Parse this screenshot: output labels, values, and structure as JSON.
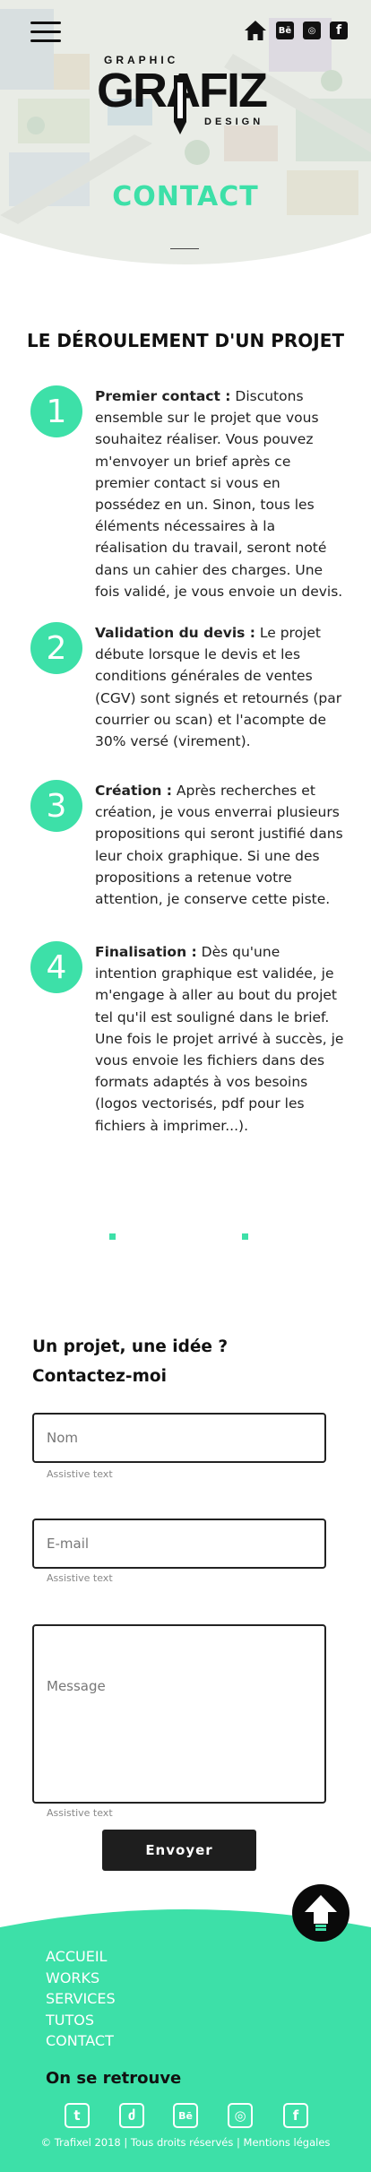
{
  "header": {
    "menu_icon": "hamburger-menu-icon",
    "icons": [
      "home-icon",
      "behance-icon",
      "dribbble-icon",
      "facebook-icon"
    ],
    "behance_glyph": "Bē",
    "dribbble_glyph": "◎",
    "facebook_glyph": "f"
  },
  "logo": {
    "top": "GRAPHIC",
    "main": "GRAFIZ",
    "bottom": "DESIGN"
  },
  "hero": {
    "title": "CONTACT"
  },
  "process": {
    "title": "LE DÉROULEMENT D'UN PROJET",
    "steps": [
      {
        "number": "1",
        "heading": "Premier contact :",
        "text": " Discutons ensemble sur le projet que vous souhaitez réaliser. Vous pouvez m'envoyer un brief après ce premier contact si vous en possédez en un. Sinon, tous les éléments nécessaires à la réalisation du travail, seront noté dans un cahier des charges. Une fois validé, je vous envoie un devis."
      },
      {
        "number": "2",
        "heading": "Validation du devis :",
        "text": " Le projet débute lorsque le devis et les conditions générales de ventes (CGV) sont signés et retournés (par courrier ou scan) et l'acompte de 30% versé (virement)."
      },
      {
        "number": "3",
        "heading": "Création :",
        "text": " Après recherches et création, je vous enverrai plusieurs propositions qui seront justifié dans leur choix graphique. Si une des propositions a retenue votre attention, je conserve cette piste."
      },
      {
        "number": "4",
        "heading": "Finalisation :",
        "text": " Dès qu'une intention graphique est validée, je m'engage à aller au bout du projet tel qu'il est souligné dans le brief. Une fois le projet arrivé à succès, je vous envoie les fichiers dans des formats adaptés à vos besoins (logos vectorisés, pdf pour les fichiers à imprimer...)."
      }
    ]
  },
  "contact": {
    "heading_line1": "Un projet, une idée ?",
    "heading_line2": "Contactez-moi",
    "name_placeholder": "Nom",
    "name_value": "",
    "email_placeholder": "E-mail",
    "email_value": "",
    "message_placeholder": "Message",
    "message_value": "",
    "assistive": "Assistive text",
    "submit_label": "Envoyer"
  },
  "footer": {
    "nav": [
      "ACCUEIL",
      "WORKS",
      "SERVICES",
      "TUTOS",
      "CONTACT"
    ],
    "heading": "On se retrouve",
    "socials": [
      {
        "icon": "tumblr-icon",
        "glyph": "t"
      },
      {
        "icon": "deviantart-icon",
        "glyph": "ძ"
      },
      {
        "icon": "behance-icon",
        "glyph": "Bē"
      },
      {
        "icon": "dribbble-icon",
        "glyph": "◎"
      },
      {
        "icon": "facebook-icon",
        "glyph": "f"
      }
    ],
    "copyright": "© Trafixel 2018 | Tous droits réservés | Mentions légales",
    "scroll_top_icon": "arrow-up-icon"
  },
  "colors": {
    "accent": "#3de0a8",
    "dark": "#1e1e1e",
    "text": "#222222"
  }
}
